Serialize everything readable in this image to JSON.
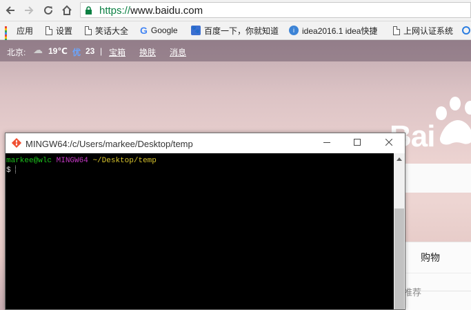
{
  "browser": {
    "url_scheme": "https://",
    "url_rest": "www.baidu.com",
    "nav_icons": [
      "back-arrow-icon",
      "forward-arrow-icon",
      "reload-icon",
      "home-icon"
    ],
    "lock_color": "#0b8043"
  },
  "bookmarks": [
    {
      "label": "应用",
      "icon": "apps-icon"
    },
    {
      "label": "设置",
      "icon": "page-icon"
    },
    {
      "label": "笑话大全",
      "icon": "page-icon"
    },
    {
      "label": "Google",
      "icon": "google-icon"
    },
    {
      "label": "百度一下，你就知道",
      "icon": "baidu-paw-icon"
    },
    {
      "label": "idea2016.1 idea快捷",
      "icon": "idea-icon"
    },
    {
      "label": "上网认证系统",
      "icon": "page-icon"
    }
  ],
  "baidu": {
    "city": "北京:",
    "temperature": "19℃",
    "aqi_value": "23",
    "separator": "|",
    "link_treasure": "宝箱",
    "link_skin": "换肤",
    "link_messages": "消息",
    "logo_text": "Bai",
    "tab_shopping": "购物",
    "recommend_text": "推荐"
  },
  "terminal": {
    "title": "MINGW64:/c/Users/markee/Desktop/temp",
    "prompt_user": "markee@wlc",
    "prompt_system": "MINGW64",
    "prompt_path": "~/Desktop/temp",
    "prompt_symbol": "$",
    "minimize_symbol": "—",
    "maximize_symbol": "☐",
    "close_symbol": "✕"
  }
}
